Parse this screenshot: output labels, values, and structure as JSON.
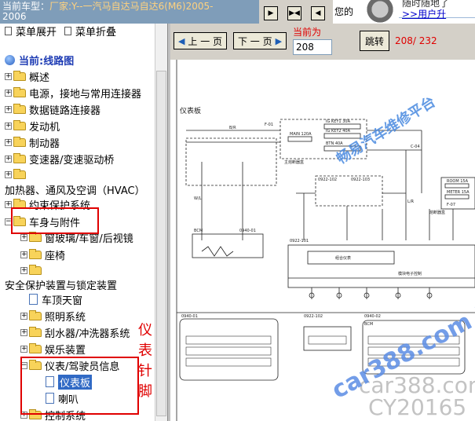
{
  "header": {
    "title_prefix": "当前车型：",
    "title_model": "厂家:Y--一汽马自达马自达6(M6)2005-",
    "title_cont": "2006",
    "btn_next": "▶",
    "btn_expand": "▶◀",
    "btn_prev": "◀",
    "cut_text": "您的",
    "help_top": "随时随地了",
    "help_link": ">>用户升"
  },
  "tree": {
    "expand_all": "菜单展开",
    "collapse_all": "菜单折叠",
    "root": "当前:线路图",
    "items": [
      {
        "label": "概述"
      },
      {
        "label": "电源，接地与常用连接器"
      },
      {
        "label": "数据链路连接器"
      },
      {
        "label": "发动机"
      },
      {
        "label": "制动器"
      },
      {
        "label": "变速器/变速驱动桥"
      },
      {
        "label": ""
      },
      {
        "label": "加热器、通风及空调（HVAC）"
      },
      {
        "label": "约束保护系统"
      },
      {
        "label": "车身与附件"
      },
      {
        "label": "窗玻璃/车窗/后视镜"
      },
      {
        "label": "座椅"
      },
      {
        "label": ""
      },
      {
        "label": "安全保护装置与锁定装置"
      },
      {
        "label": "车顶天窗"
      },
      {
        "label": "照明系统"
      },
      {
        "label": "刮水器/冲洗器系统"
      },
      {
        "label": "娱乐装置"
      },
      {
        "label": "仪表/驾驶员信息"
      },
      {
        "label": "仪表板"
      },
      {
        "label": "喇叭"
      },
      {
        "label": "控制系统"
      }
    ],
    "annotation": "仪表针脚"
  },
  "toolbar": {
    "prev_label": "上 一 页",
    "next_label": "下 一 页",
    "current_label": "当前为",
    "current_page": "208",
    "jump_label": "跳转",
    "page_count": "208/ 232"
  },
  "diagram": {
    "title": "仪表板",
    "watermark_platform": "畅易汽车维修平台",
    "watermark_blue": "car388.com 20165",
    "watermark_gray1": "car388.com",
    "watermark_gray2": "CY20165",
    "labels": {
      "fuse_f01": "F-01",
      "ig_key1_30a": "IG KEY1 30A",
      "ig_key2_40a": "IG KEY2 40A",
      "main_120a": "MAIN 120A",
      "btn_40a": "BTN 40A",
      "main_fuse_box": "主熔断器盒",
      "c04": "C-04",
      "room_15a": "ROOM 15A",
      "meter_15a": "METER 15A",
      "fuse_f07": "F-07",
      "fuse_block": "熔断器盒",
      "bcm": "BCM",
      "conn_0940_01": "0940-01",
      "conn_0922_101": "0922-101",
      "conn_0922_102": "0922-102",
      "conn_0922_103": "0922-103",
      "cluster": "组合仪表",
      "cluster_sub": "模块电子控制",
      "cap_0940": "0940-01",
      "cap_0922": "0922-102",
      "cap_bcm": "0940-02",
      "bottom_bcm": "BCM",
      "pin_a": "B/R",
      "pin_b": "W/L",
      "pin_c": "L/R"
    }
  },
  "colors": {
    "accent_red": "#e00000",
    "selection": "#316ac5",
    "toolbar_bg": "#d4d0c8",
    "title_bar": "#7f9db9",
    "folder": "#f8d35a"
  }
}
